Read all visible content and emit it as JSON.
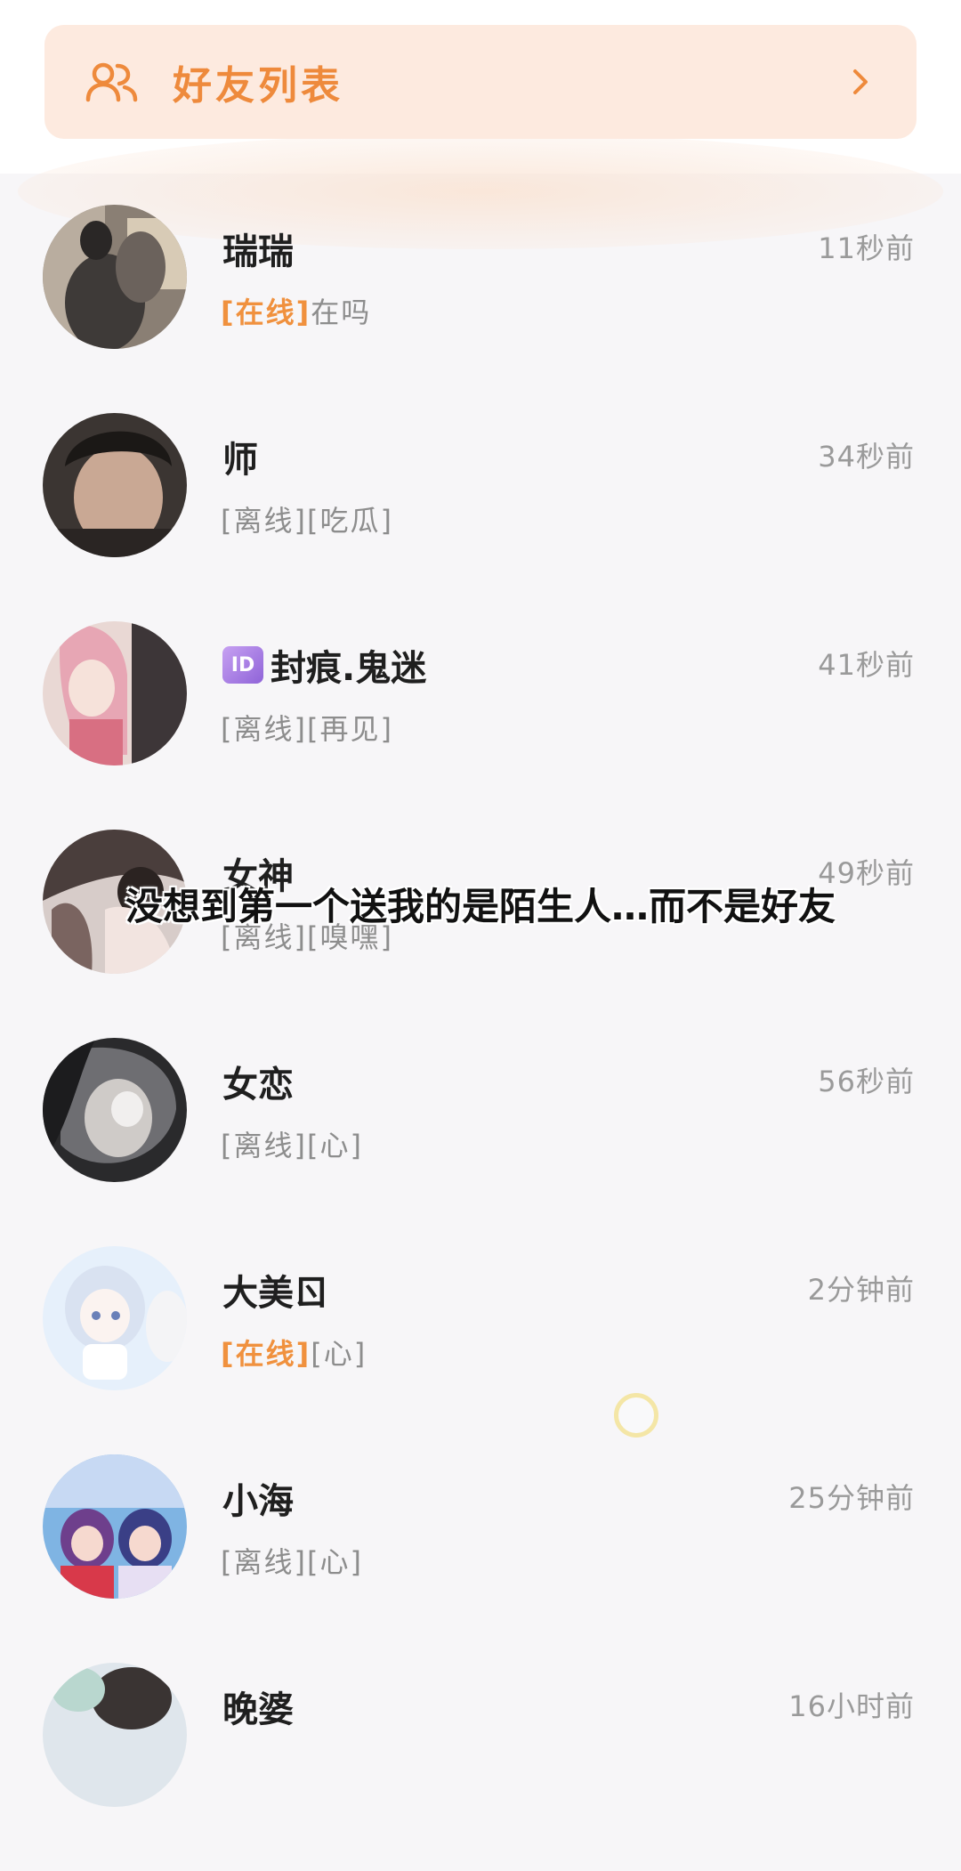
{
  "header": {
    "friends_list_label": "好友列表",
    "friends_icon": "users-icon",
    "chevron_icon": "chevron-right-icon"
  },
  "caption": "没想到第一个送我的是陌生人…而不是好友",
  "colors": {
    "online": "#f0913e",
    "card_bg": "#fdeadf",
    "accent": "#ee8a3c"
  },
  "contacts": [
    {
      "name": "瑞瑞",
      "status": "[在线]",
      "message": "在吗",
      "time": "11秒前",
      "online": true,
      "badge": ""
    },
    {
      "name": "师",
      "status": "[离线]",
      "message": "[吃瓜]",
      "time": "34秒前",
      "online": false,
      "badge": ""
    },
    {
      "name": "封痕.鬼迷",
      "status": "[离线]",
      "message": "[再见]",
      "time": "41秒前",
      "online": false,
      "badge": "ID"
    },
    {
      "name": "女神",
      "status": "[离线]",
      "message": "[嗅嘿]",
      "time": "49秒前",
      "online": false,
      "badge": ""
    },
    {
      "name": "女恋",
      "status": "[离线]",
      "message": "[心]",
      "time": "56秒前",
      "online": false,
      "badge": ""
    },
    {
      "name": "大美ㄖ",
      "status": "[在线]",
      "message": "[心]",
      "time": "2分钟前",
      "online": true,
      "badge": ""
    },
    {
      "name": "小海",
      "status": "[离线]",
      "message": "[心]",
      "time": "25分钟前",
      "online": false,
      "badge": ""
    },
    {
      "name": "晚婆",
      "status": "",
      "message": "",
      "time": "16小时前",
      "online": false,
      "badge": ""
    }
  ]
}
